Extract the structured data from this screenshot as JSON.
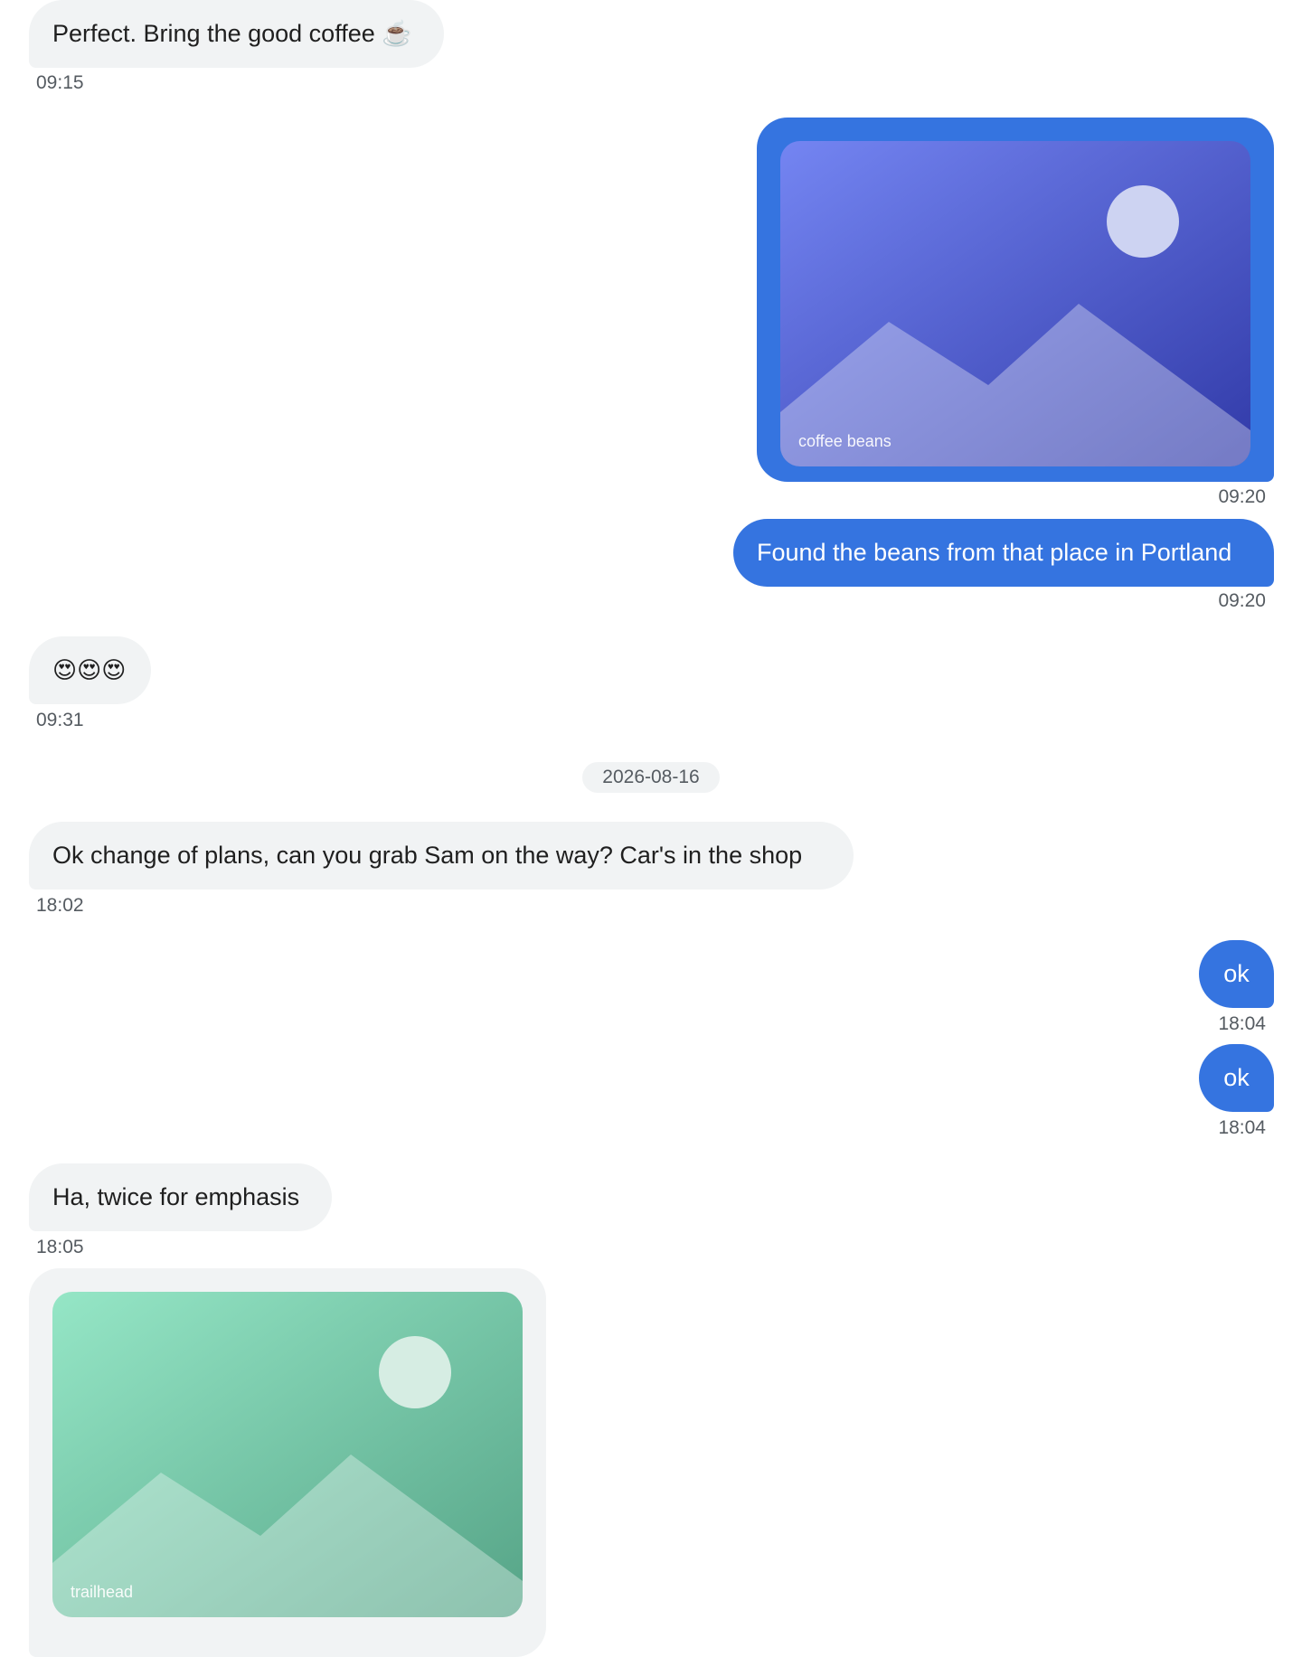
{
  "messages": [
    {
      "direction": "incoming",
      "type": "text",
      "text": "Perfect. Bring the good coffee ☕",
      "time": "09:15"
    },
    {
      "direction": "outgoing",
      "type": "image",
      "caption": "coffee beans",
      "time": "09:20",
      "colors": {
        "bubble": "#3574e0",
        "gradient_start": "#7485f2",
        "gradient_end": "#313aa8"
      }
    },
    {
      "direction": "outgoing",
      "type": "text",
      "text": "Found the beans from that place in Portland",
      "time": "09:20"
    },
    {
      "direction": "incoming",
      "type": "text",
      "text": "😍😍😍",
      "time": "09:31"
    },
    {
      "direction": "incoming",
      "type": "text",
      "text": "Ok change of plans, can you grab Sam on the way? Car's in the shop",
      "time": "18:02"
    },
    {
      "direction": "outgoing",
      "type": "text",
      "text": "ok",
      "time": "18:04"
    },
    {
      "direction": "outgoing",
      "type": "text",
      "text": "ok",
      "time": "18:04"
    },
    {
      "direction": "incoming",
      "type": "text",
      "text": "Ha, twice for emphasis",
      "time": "18:05"
    },
    {
      "direction": "incoming",
      "type": "image",
      "caption": "trailhead",
      "colors": {
        "bubble": "#f1f3f4",
        "gradient_start": "#95e6c6",
        "gradient_end": "#56a487"
      }
    }
  ],
  "date_separator": "2026-08-16",
  "icons": [
    "image-placeholder-icon"
  ],
  "colors": {
    "incoming_bubble": "#f1f3f4",
    "outgoing_bubble": "#3574e0",
    "timestamp": "#555b61"
  }
}
